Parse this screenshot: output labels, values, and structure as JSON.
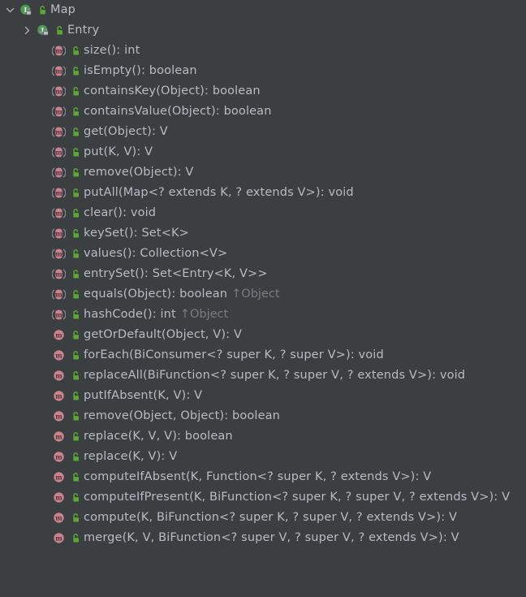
{
  "window": {
    "kind": "structure-tree",
    "background_color": "#3c3f41",
    "text_color": "#b6bcc4",
    "inherited_text_color": "#787d83",
    "interface_icon_color": "#4e9a53",
    "method_icon_color": "#c9848f",
    "padlock_color": "#5aa832"
  },
  "tree": {
    "nodes": [
      {
        "label": "Map",
        "icon": "interface-icon",
        "visibility_icon": "public-unlocked-padlock-icon",
        "expander": "chevron-down-icon",
        "depth": 0,
        "inherited_from": ""
      },
      {
        "label": "Entry",
        "icon": "nested-interface-icon",
        "visibility_icon": "public-unlocked-padlock-icon",
        "expander": "chevron-right-icon",
        "depth": 1,
        "inherited_from": ""
      },
      {
        "label": "size(): int",
        "icon": "abstract-method-icon",
        "visibility_icon": "public-unlocked-padlock-icon",
        "expander": "none",
        "depth": 2,
        "inherited_from": ""
      },
      {
        "label": "isEmpty(): boolean",
        "icon": "abstract-method-icon",
        "visibility_icon": "public-unlocked-padlock-icon",
        "expander": "none",
        "depth": 2,
        "inherited_from": ""
      },
      {
        "label": "containsKey(Object): boolean",
        "icon": "abstract-method-icon",
        "visibility_icon": "public-unlocked-padlock-icon",
        "expander": "none",
        "depth": 2,
        "inherited_from": ""
      },
      {
        "label": "containsValue(Object): boolean",
        "icon": "abstract-method-icon",
        "visibility_icon": "public-unlocked-padlock-icon",
        "expander": "none",
        "depth": 2,
        "inherited_from": ""
      },
      {
        "label": "get(Object): V",
        "icon": "abstract-method-icon",
        "visibility_icon": "public-unlocked-padlock-icon",
        "expander": "none",
        "depth": 2,
        "inherited_from": ""
      },
      {
        "label": "put(K, V): V",
        "icon": "abstract-method-icon",
        "visibility_icon": "public-unlocked-padlock-icon",
        "expander": "none",
        "depth": 2,
        "inherited_from": ""
      },
      {
        "label": "remove(Object): V",
        "icon": "abstract-method-icon",
        "visibility_icon": "public-unlocked-padlock-icon",
        "expander": "none",
        "depth": 2,
        "inherited_from": ""
      },
      {
        "label": "putAll(Map<? extends K, ? extends V>): void",
        "icon": "abstract-method-icon",
        "visibility_icon": "public-unlocked-padlock-icon",
        "expander": "none",
        "depth": 2,
        "inherited_from": ""
      },
      {
        "label": "clear(): void",
        "icon": "abstract-method-icon",
        "visibility_icon": "public-unlocked-padlock-icon",
        "expander": "none",
        "depth": 2,
        "inherited_from": ""
      },
      {
        "label": "keySet(): Set<K>",
        "icon": "abstract-method-icon",
        "visibility_icon": "public-unlocked-padlock-icon",
        "expander": "none",
        "depth": 2,
        "inherited_from": ""
      },
      {
        "label": "values(): Collection<V>",
        "icon": "abstract-method-icon",
        "visibility_icon": "public-unlocked-padlock-icon",
        "expander": "none",
        "depth": 2,
        "inherited_from": ""
      },
      {
        "label": "entrySet(): Set<Entry<K, V>>",
        "icon": "abstract-method-icon",
        "visibility_icon": "public-unlocked-padlock-icon",
        "expander": "none",
        "depth": 2,
        "inherited_from": ""
      },
      {
        "label": "equals(Object): boolean",
        "icon": "abstract-method-icon",
        "visibility_icon": "public-unlocked-padlock-icon",
        "expander": "none",
        "depth": 2,
        "inherited_from": "↑Object"
      },
      {
        "label": "hashCode(): int",
        "icon": "abstract-method-icon",
        "visibility_icon": "public-unlocked-padlock-icon",
        "expander": "none",
        "depth": 2,
        "inherited_from": "↑Object"
      },
      {
        "label": "getOrDefault(Object, V): V",
        "icon": "default-method-icon",
        "visibility_icon": "public-unlocked-padlock-icon",
        "expander": "none",
        "depth": 2,
        "inherited_from": ""
      },
      {
        "label": "forEach(BiConsumer<? super K, ? super V>): void",
        "icon": "default-method-icon",
        "visibility_icon": "public-unlocked-padlock-icon",
        "expander": "none",
        "depth": 2,
        "inherited_from": ""
      },
      {
        "label": "replaceAll(BiFunction<? super K, ? super V, ? extends V>): void",
        "icon": "default-method-icon",
        "visibility_icon": "public-unlocked-padlock-icon",
        "expander": "none",
        "depth": 2,
        "inherited_from": ""
      },
      {
        "label": "putIfAbsent(K, V): V",
        "icon": "default-method-icon",
        "visibility_icon": "public-unlocked-padlock-icon",
        "expander": "none",
        "depth": 2,
        "inherited_from": ""
      },
      {
        "label": "remove(Object, Object): boolean",
        "icon": "default-method-icon",
        "visibility_icon": "public-unlocked-padlock-icon",
        "expander": "none",
        "depth": 2,
        "inherited_from": ""
      },
      {
        "label": "replace(K, V, V): boolean",
        "icon": "default-method-icon",
        "visibility_icon": "public-unlocked-padlock-icon",
        "expander": "none",
        "depth": 2,
        "inherited_from": ""
      },
      {
        "label": "replace(K, V): V",
        "icon": "default-method-icon",
        "visibility_icon": "public-unlocked-padlock-icon",
        "expander": "none",
        "depth": 2,
        "inherited_from": ""
      },
      {
        "label": "computeIfAbsent(K, Function<? super K, ? extends V>): V",
        "icon": "default-method-icon",
        "visibility_icon": "public-unlocked-padlock-icon",
        "expander": "none",
        "depth": 2,
        "inherited_from": ""
      },
      {
        "label": "computeIfPresent(K, BiFunction<? super K, ? super V, ? extends V>): V",
        "icon": "default-method-icon",
        "visibility_icon": "public-unlocked-padlock-icon",
        "expander": "none",
        "depth": 2,
        "inherited_from": ""
      },
      {
        "label": "compute(K, BiFunction<? super K, ? super V, ? extends V>): V",
        "icon": "default-method-icon",
        "visibility_icon": "public-unlocked-padlock-icon",
        "expander": "none",
        "depth": 2,
        "inherited_from": ""
      },
      {
        "label": "merge(K, V, BiFunction<? super V, ? super V, ? extends V>): V",
        "icon": "default-method-icon",
        "visibility_icon": "public-unlocked-padlock-icon",
        "expander": "none",
        "depth": 2,
        "inherited_from": ""
      }
    ]
  }
}
